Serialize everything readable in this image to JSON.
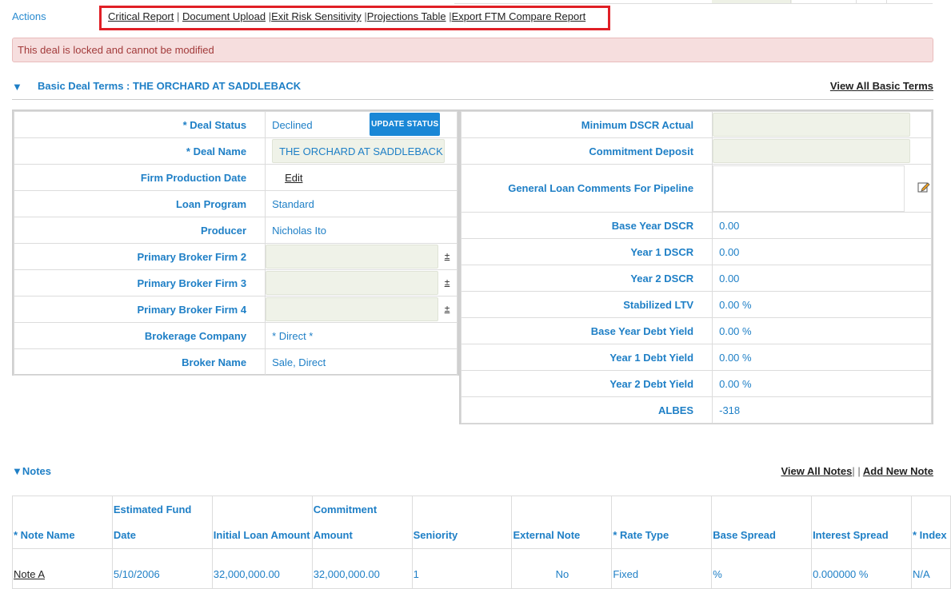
{
  "actions": {
    "label": "Actions",
    "links": [
      "Critical Report",
      "Document Upload",
      "Exit Risk Sensitivity",
      "Projections Table",
      "Export FTM Compare Report"
    ],
    "separator": "|"
  },
  "alert": {
    "text": "This deal is locked and cannot be modified"
  },
  "basic_terms": {
    "toggle": "▼",
    "title": "Basic Deal Terms : THE ORCHARD AT SADDLEBACK",
    "view_all": "View All Basic Terms",
    "left": {
      "deal_status_label": "* Deal Status",
      "deal_status_value": "Declined",
      "update_status_button": "UPDATE STATUS",
      "deal_name_label": "* Deal Name",
      "deal_name_value": "THE ORCHARD AT SADDLEBACK",
      "firm_production_date_label": "Firm Production Date",
      "edit_link": "Edit",
      "loan_program_label": "Loan Program",
      "loan_program_value": "Standard",
      "producer_label": "Producer",
      "producer_value": "Nicholas Ito",
      "primary_broker_2_label": "Primary Broker Firm 2",
      "primary_broker_3_label": "Primary Broker Firm 3",
      "primary_broker_4_label": "Primary Broker Firm 4",
      "plus_minus": "±",
      "brokerage_company_label": "Brokerage Company",
      "brokerage_company_value": "* Direct *",
      "broker_name_label": "Broker Name",
      "broker_name_value": "Sale, Direct"
    },
    "right": {
      "min_dscr_label": "Minimum DSCR Actual",
      "commitment_deposit_label": "Commitment Deposit",
      "general_comments_label": "General Loan Comments For Pipeline",
      "base_year_dscr_label": "Base Year DSCR",
      "base_year_dscr_value": "0.00",
      "year1_dscr_label": "Year 1 DSCR",
      "year1_dscr_value": "0.00",
      "year2_dscr_label": "Year 2 DSCR",
      "year2_dscr_value": "0.00",
      "stabilized_ltv_label": "Stabilized LTV",
      "stabilized_ltv_value": "0.00 %",
      "base_year_debt_yield_label": "Base Year Debt Yield",
      "base_year_debt_yield_value": "0.00 %",
      "year1_debt_yield_label": "Year 1 Debt Yield",
      "year1_debt_yield_value": "0.00 %",
      "year2_debt_yield_label": "Year 2 Debt Yield",
      "year2_debt_yield_value": "0.00 %",
      "albes_label": "ALBES",
      "albes_value": "-318"
    }
  },
  "notes": {
    "title": "▼Notes",
    "view_all": "View All Notes",
    "link_sep": "|",
    "add_new": "Add New Note",
    "headers": {
      "note_name": "* Note Name",
      "est_fund_l1": "Estimated Fund",
      "est_fund_l2": "Date",
      "initial_loan": "Initial Loan Amount",
      "commitment_l1": "Commitment",
      "commitment_l2": "Amount",
      "seniority": "Seniority",
      "external_note": "External Note",
      "rate_type": "* Rate Type",
      "base_spread": "Base Spread",
      "interest_spread": "Interest Spread",
      "index": "* Index"
    },
    "row": {
      "note_name": "Note A",
      "est_fund_date": "5/10/2006",
      "initial_loan": "32,000,000.00",
      "commitment": "32,000,000.00",
      "seniority": "1",
      "external_note": "No",
      "rate_type": "Fixed",
      "base_spread": "%",
      "interest_spread": "0.000000 %",
      "index": "N/A"
    }
  }
}
